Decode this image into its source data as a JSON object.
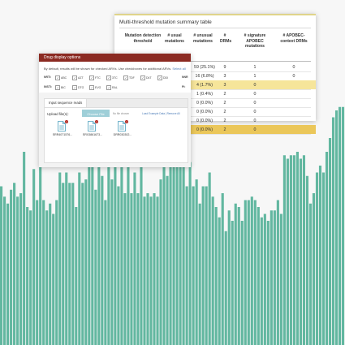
{
  "colors": {
    "bar": "#62b7a0",
    "drug_header": "#8b2a22",
    "highlight_light": "#f6e59a",
    "highlight_strong": "#ebc75a",
    "choose_button": "#9fcfd8",
    "delete_badge": "#b3261e",
    "file_icon": "#4a9fbd"
  },
  "background_bars": {
    "values": [
      0.46,
      0.43,
      0.41,
      0.45,
      0.47,
      0.43,
      0.44,
      0.56,
      0.4,
      0.39,
      0.51,
      0.42,
      0.6,
      0.42,
      0.39,
      0.41,
      0.38,
      0.42,
      0.5,
      0.47,
      0.5,
      0.47,
      0.47,
      0.4,
      0.5,
      0.47,
      0.48,
      0.52,
      0.52,
      0.45,
      0.52,
      0.49,
      0.42,
      0.52,
      0.48,
      0.6,
      0.46,
      0.52,
      0.44,
      0.52,
      0.44,
      0.5,
      0.44,
      0.53,
      0.43,
      0.44,
      0.43,
      0.44,
      0.43,
      0.48,
      0.58,
      0.49,
      0.56,
      0.53,
      0.54,
      0.53,
      0.55,
      0.46,
      0.53,
      0.46,
      0.48,
      0.41,
      0.46,
      0.46,
      0.5,
      0.43,
      0.4,
      0.37,
      0.44,
      0.33,
      0.39,
      0.36,
      0.41,
      0.4,
      0.36,
      0.42,
      0.42,
      0.43,
      0.42,
      0.4,
      0.37,
      0.38,
      0.36,
      0.39,
      0.39,
      0.42,
      0.38,
      0.55,
      0.54,
      0.55,
      0.55,
      0.56,
      0.54,
      0.55,
      0.49,
      0.41,
      0.44,
      0.5,
      0.52,
      0.5,
      0.56,
      0.6,
      0.66,
      0.68,
      0.69,
      0.69
    ]
  },
  "summary_table": {
    "title": "Multi-threshold mutation summary table",
    "headers": [
      "Mutation detection threshold",
      "# usual mutations",
      "# unusual mutations",
      "# DRMs",
      "# signature APOBEC mutations",
      "# APOBEC-context DRMs"
    ],
    "rows": [
      {
        "c1": "",
        "c2": "59 (25.1%)",
        "c3": "9",
        "c4": "1",
        "c5": "0",
        "hl": ""
      },
      {
        "c1": "",
        "c2": "16 (6.8%)",
        "c3": "3",
        "c4": "1",
        "c5": "0",
        "hl": ""
      },
      {
        "c1": "",
        "c2": "4 (1.7%)",
        "c3": "3",
        "c4": "0",
        "c5": "",
        "hl": "light"
      },
      {
        "c1": "",
        "c2": "1 (0.4%)",
        "c3": "2",
        "c4": "0",
        "c5": "",
        "hl": ""
      },
      {
        "c1": "",
        "c2": "0 (0.0%)",
        "c3": "2",
        "c4": "0",
        "c5": "",
        "hl": ""
      },
      {
        "c1": "",
        "c2": "0 (0.0%)",
        "c3": "2",
        "c4": "0",
        "c5": "",
        "hl": ""
      },
      {
        "c1": "",
        "c2": "0 (0.0%)",
        "c3": "2",
        "c4": "0",
        "c5": "",
        "hl": ""
      },
      {
        "c1": "",
        "c2": "0 (0.0%)",
        "c3": "2",
        "c4": "0",
        "c5": "",
        "hl": "strong"
      }
    ]
  },
  "drug_display": {
    "title": "Drug display options",
    "note": "By default, results will be shown for checked ARVs. Use checkboxes for additional ARVs.",
    "note_link": "Select all",
    "nrti_label": "NRTI:",
    "nrti": [
      "ABC",
      "AZT",
      "FTC",
      "3TC",
      "TDF",
      "D4T",
      "DDI"
    ],
    "insti_label": "INSTI:",
    "insti": [
      "BIC",
      "DTG",
      "EVG",
      "RAL"
    ],
    "right_label_1": "NNR",
    "right_label_2": "PI:"
  },
  "reads": {
    "tab_label": "Input sequence reads",
    "upload_label": "Upload file(s):",
    "choose_label": "Choose File",
    "no_file": "No file chosen",
    "links": "Load Example Data | Remove All",
    "files": [
      "SRR4071576...",
      "SRX3861673...",
      "DRR030302..."
    ]
  }
}
